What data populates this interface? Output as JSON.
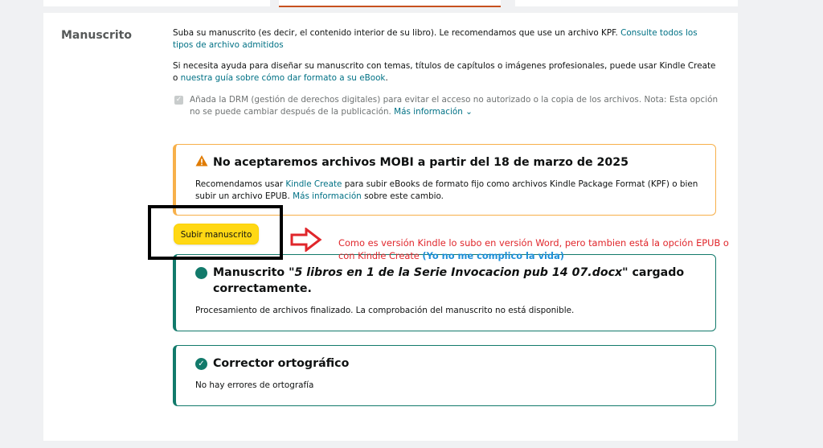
{
  "manuscript": {
    "label": "Manuscrito",
    "intro": "Suba su manuscrito (es decir, el contenido interior de su libro). Le recomendamos que use un archivo KPF. ",
    "intro_link": "Consulte todos los tipos de archivo admitidos",
    "help": "Si necesita ayuda para diseñar su manuscrito con temas, títulos de capítulos o imágenes profesionales, puede usar Kindle Create o ",
    "help_link": "nuestra guía sobre cómo dar formato a su eBook",
    "help_end": ".",
    "drm_text": "Añada la DRM (gestión de derechos digitales) para evitar el acceso no autorizado o la copia de los archivos. Nota: Esta opción no se puede cambiar después de la publicación. ",
    "drm_more": "Más información",
    "drm_checked": true
  },
  "warning": {
    "title": "No aceptaremos archivos MOBI a partir del 18 de marzo de 2025",
    "body_1": "Recomendamos usar ",
    "body_link_1": "Kindle Create",
    "body_2": " para subir eBooks de formato fijo como archivos Kindle Package Format (KPF) o bien subir un archivo EPUB. ",
    "body_link_2": "Más información",
    "body_3": " sobre este cambio."
  },
  "upload_button": "Subir manuscrito",
  "success": {
    "title_1": "Manuscrito \"",
    "filename": "5 libros en 1 de la Serie Invocacion pub 14 07.docx",
    "title_2": "\" cargado correctamente.",
    "body": "Procesamiento de archivos finalizado. La comprobación del manuscrito no está disponible."
  },
  "spellcheck": {
    "title": "Corrector ortográfico",
    "body": "No hay errores de ortografía"
  },
  "annotation": {
    "text": "Como es versión Kindle lo subo en versión Word, pero tambien está la opción EPUB o con Kindle Create ",
    "highlight": "(Yo no me complico la vida)"
  },
  "colors": {
    "warning_border": "#f7b04a",
    "success": "#127a6b",
    "button": "#ffd814",
    "link": "#007185",
    "annotation": "#e0262b"
  }
}
